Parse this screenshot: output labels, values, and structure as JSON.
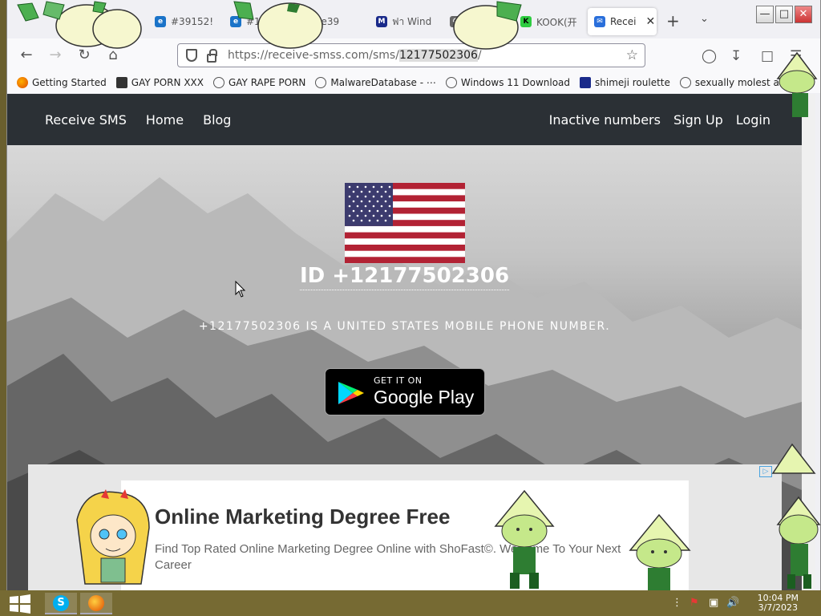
{
  "browser": {
    "tabs": [
      {
        "label": "#39152!",
        "icon": "edge-icon",
        "active": false
      },
      {
        "label": "#17... 6d4aa58e39",
        "icon": "edge-icon",
        "active": false
      },
      {
        "label": "ฟา Wind",
        "icon": "mft-icon",
        "active": false
      },
      {
        "label": "",
        "icon": "puzzle-icon",
        "active": false
      },
      {
        "label": "KOOK(开",
        "icon": "kook-icon",
        "active": false
      },
      {
        "label": "Recei",
        "icon": "chat-icon",
        "active": true
      }
    ],
    "new_tab": "+",
    "tab_list": "⌄",
    "url": {
      "prefix": "https://receive-smss.com/sms/",
      "selected": "12177502306",
      "suffix": "/"
    },
    "bookmarks": [
      {
        "label": "Getting Started",
        "icon": "firefox-icon"
      },
      {
        "label": "GAY PORN XXX",
        "icon": "pc-icon"
      },
      {
        "label": "GAY RAPE PORN",
        "icon": "globe-icon"
      },
      {
        "label": "MalwareDatabase - ⋯",
        "icon": "globe-icon"
      },
      {
        "label": "Windows 11 Download",
        "icon": "globe-icon"
      },
      {
        "label": "shimeji roulette",
        "icon": "mft-icon"
      },
      {
        "label": "sexually molest ai",
        "icon": "globe-icon"
      }
    ]
  },
  "site": {
    "nav_left": [
      "Receive SMS",
      "Home",
      "Blog"
    ],
    "nav_right": [
      "Inactive numbers",
      "Sign Up",
      "Login"
    ],
    "id_text": "ID +12177502306",
    "subtitle": "+12177502306 IS A UNITED STATES MOBILE PHONE NUMBER.",
    "gplay_small": "GET IT ON",
    "gplay_big": "Google Play"
  },
  "ad": {
    "headline": "Online Marketing Degree Free",
    "description": "Find Top Rated Online Marketing Degree Online with ShoFast©. Welcome To Your Next Career"
  },
  "taskbar": {
    "time": "10:04 PM",
    "date": "3/7/2023"
  },
  "colors": {
    "site_nav_bg": "#2b3035",
    "taskbar_bg": "#766a33"
  }
}
